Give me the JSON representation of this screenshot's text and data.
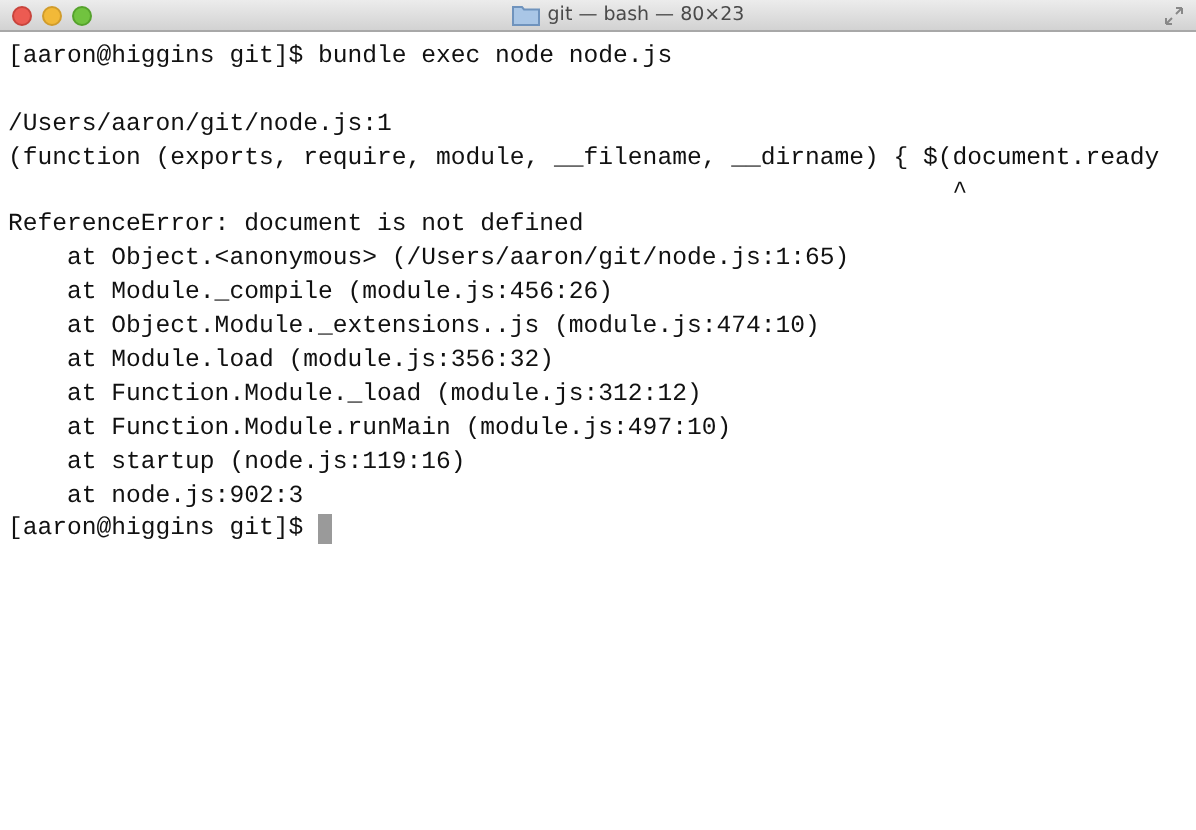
{
  "window": {
    "title": "git — bash — 80×23"
  },
  "terminal": {
    "lines": [
      {
        "kind": "text",
        "text": "[aaron@higgins git]$ bundle exec node node.js"
      },
      {
        "kind": "blank"
      },
      {
        "kind": "text",
        "text": "/Users/aaron/git/node.js:1"
      },
      {
        "kind": "text",
        "text": "(function (exports, require, module, __filename, __dirname) { $(document.ready"
      },
      {
        "kind": "text",
        "text": "                                                                ^"
      },
      {
        "kind": "text",
        "text": "ReferenceError: document is not defined"
      },
      {
        "kind": "text",
        "text": "    at Object.<anonymous> (/Users/aaron/git/node.js:1:65)"
      },
      {
        "kind": "text",
        "text": "    at Module._compile (module.js:456:26)"
      },
      {
        "kind": "text",
        "text": "    at Object.Module._extensions..js (module.js:474:10)"
      },
      {
        "kind": "text",
        "text": "    at Module.load (module.js:356:32)"
      },
      {
        "kind": "text",
        "text": "    at Function.Module._load (module.js:312:12)"
      },
      {
        "kind": "text",
        "text": "    at Function.Module.runMain (module.js:497:10)"
      },
      {
        "kind": "text",
        "text": "    at startup (node.js:119:16)"
      },
      {
        "kind": "text",
        "text": "    at node.js:902:3"
      }
    ],
    "prompt": "[aaron@higgins git]$ "
  }
}
